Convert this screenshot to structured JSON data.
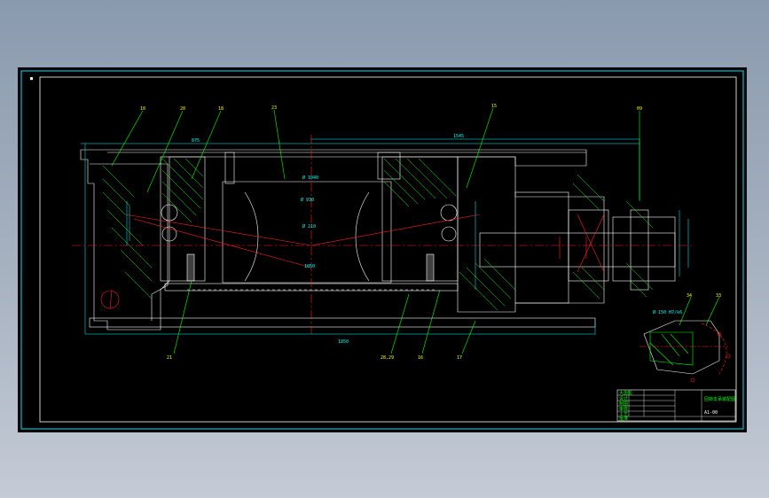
{
  "sheet": {
    "corner_mark": "■",
    "colors": {
      "frame": "#00e5ff",
      "outline": "#ffffff",
      "hatch": "#00ff00",
      "center": "#ff2222",
      "dimension": "#00ffff",
      "leader": "#00ff00",
      "label": "#ffff00"
    }
  },
  "callouts": {
    "c1": "10",
    "c2": "20",
    "c3": "18",
    "c4": "23",
    "c5": "15",
    "c6": "09",
    "c7": "21",
    "c8": "28,29",
    "c9": "16",
    "c10": "17",
    "c11": "34",
    "c12": "33"
  },
  "dimensions": {
    "overall_width": "1850",
    "top_dim": "875",
    "top_dim2": "1545",
    "inner": "Ø 1040",
    "bore": "Ø 930",
    "shaft": "Ø 210",
    "base": "1050",
    "detail_note": "Ø 150 H7/k6"
  },
  "title_block": {
    "rows": [
      "大齿轮",
      "设计",
      "制图",
      "审核",
      "工艺",
      "批准"
    ],
    "right_title": "回转支承装配图",
    "drawing_no": "A1-00"
  }
}
